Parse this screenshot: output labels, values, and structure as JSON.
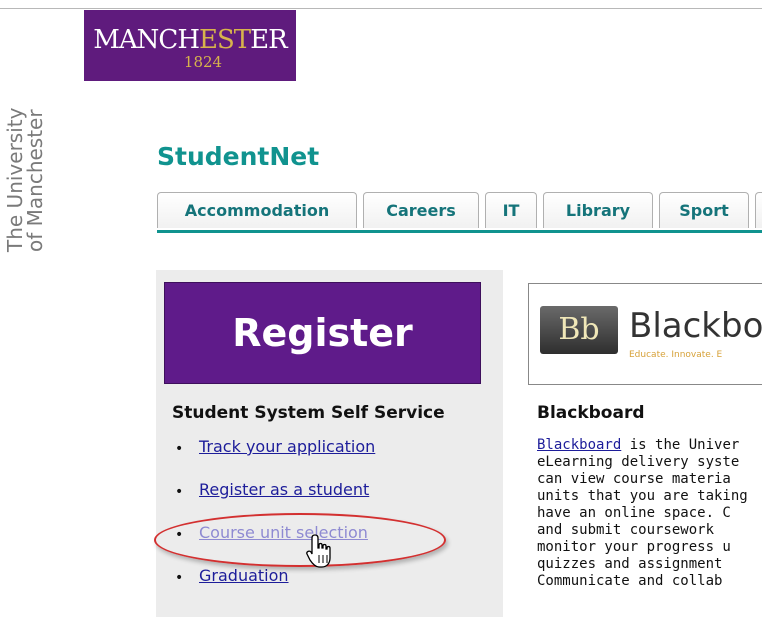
{
  "logo": {
    "word_part1": "MANCH",
    "word_gold": "EST",
    "word_part2": "ER",
    "year": "1824"
  },
  "university_side": {
    "line1": "The University",
    "line2": "of Manchester"
  },
  "site_title": "StudentNet",
  "tabs": [
    {
      "label": "Accommodation"
    },
    {
      "label": "Careers"
    },
    {
      "label": "IT"
    },
    {
      "label": "Library"
    },
    {
      "label": "Sport"
    }
  ],
  "register": {
    "banner": "Register",
    "heading": "Student System Self Service",
    "links": [
      {
        "label": "Track your application"
      },
      {
        "label": "Register as a student"
      },
      {
        "label": "Course unit selection"
      },
      {
        "label": "Graduation"
      }
    ]
  },
  "blackboard": {
    "logo_mark": "Bb",
    "logo_word": "Blackbo",
    "tagline": "Educate. Innovate. E",
    "heading": "Blackboard",
    "link": "Blackboard",
    "line1_rest": " is the Univer",
    "lines": [
      "eLearning delivery syste",
      "can view course materia",
      "units that you are taking",
      "have an online space.  C",
      "and submit coursework",
      "monitor your progress u",
      "quizzes and assignment",
      "Communicate and collab"
    ]
  },
  "colors": {
    "brand_purple": "#5f1b7d",
    "teal": "#10938f",
    "gold": "#d7b34c",
    "highlight_red": "#d33030"
  }
}
